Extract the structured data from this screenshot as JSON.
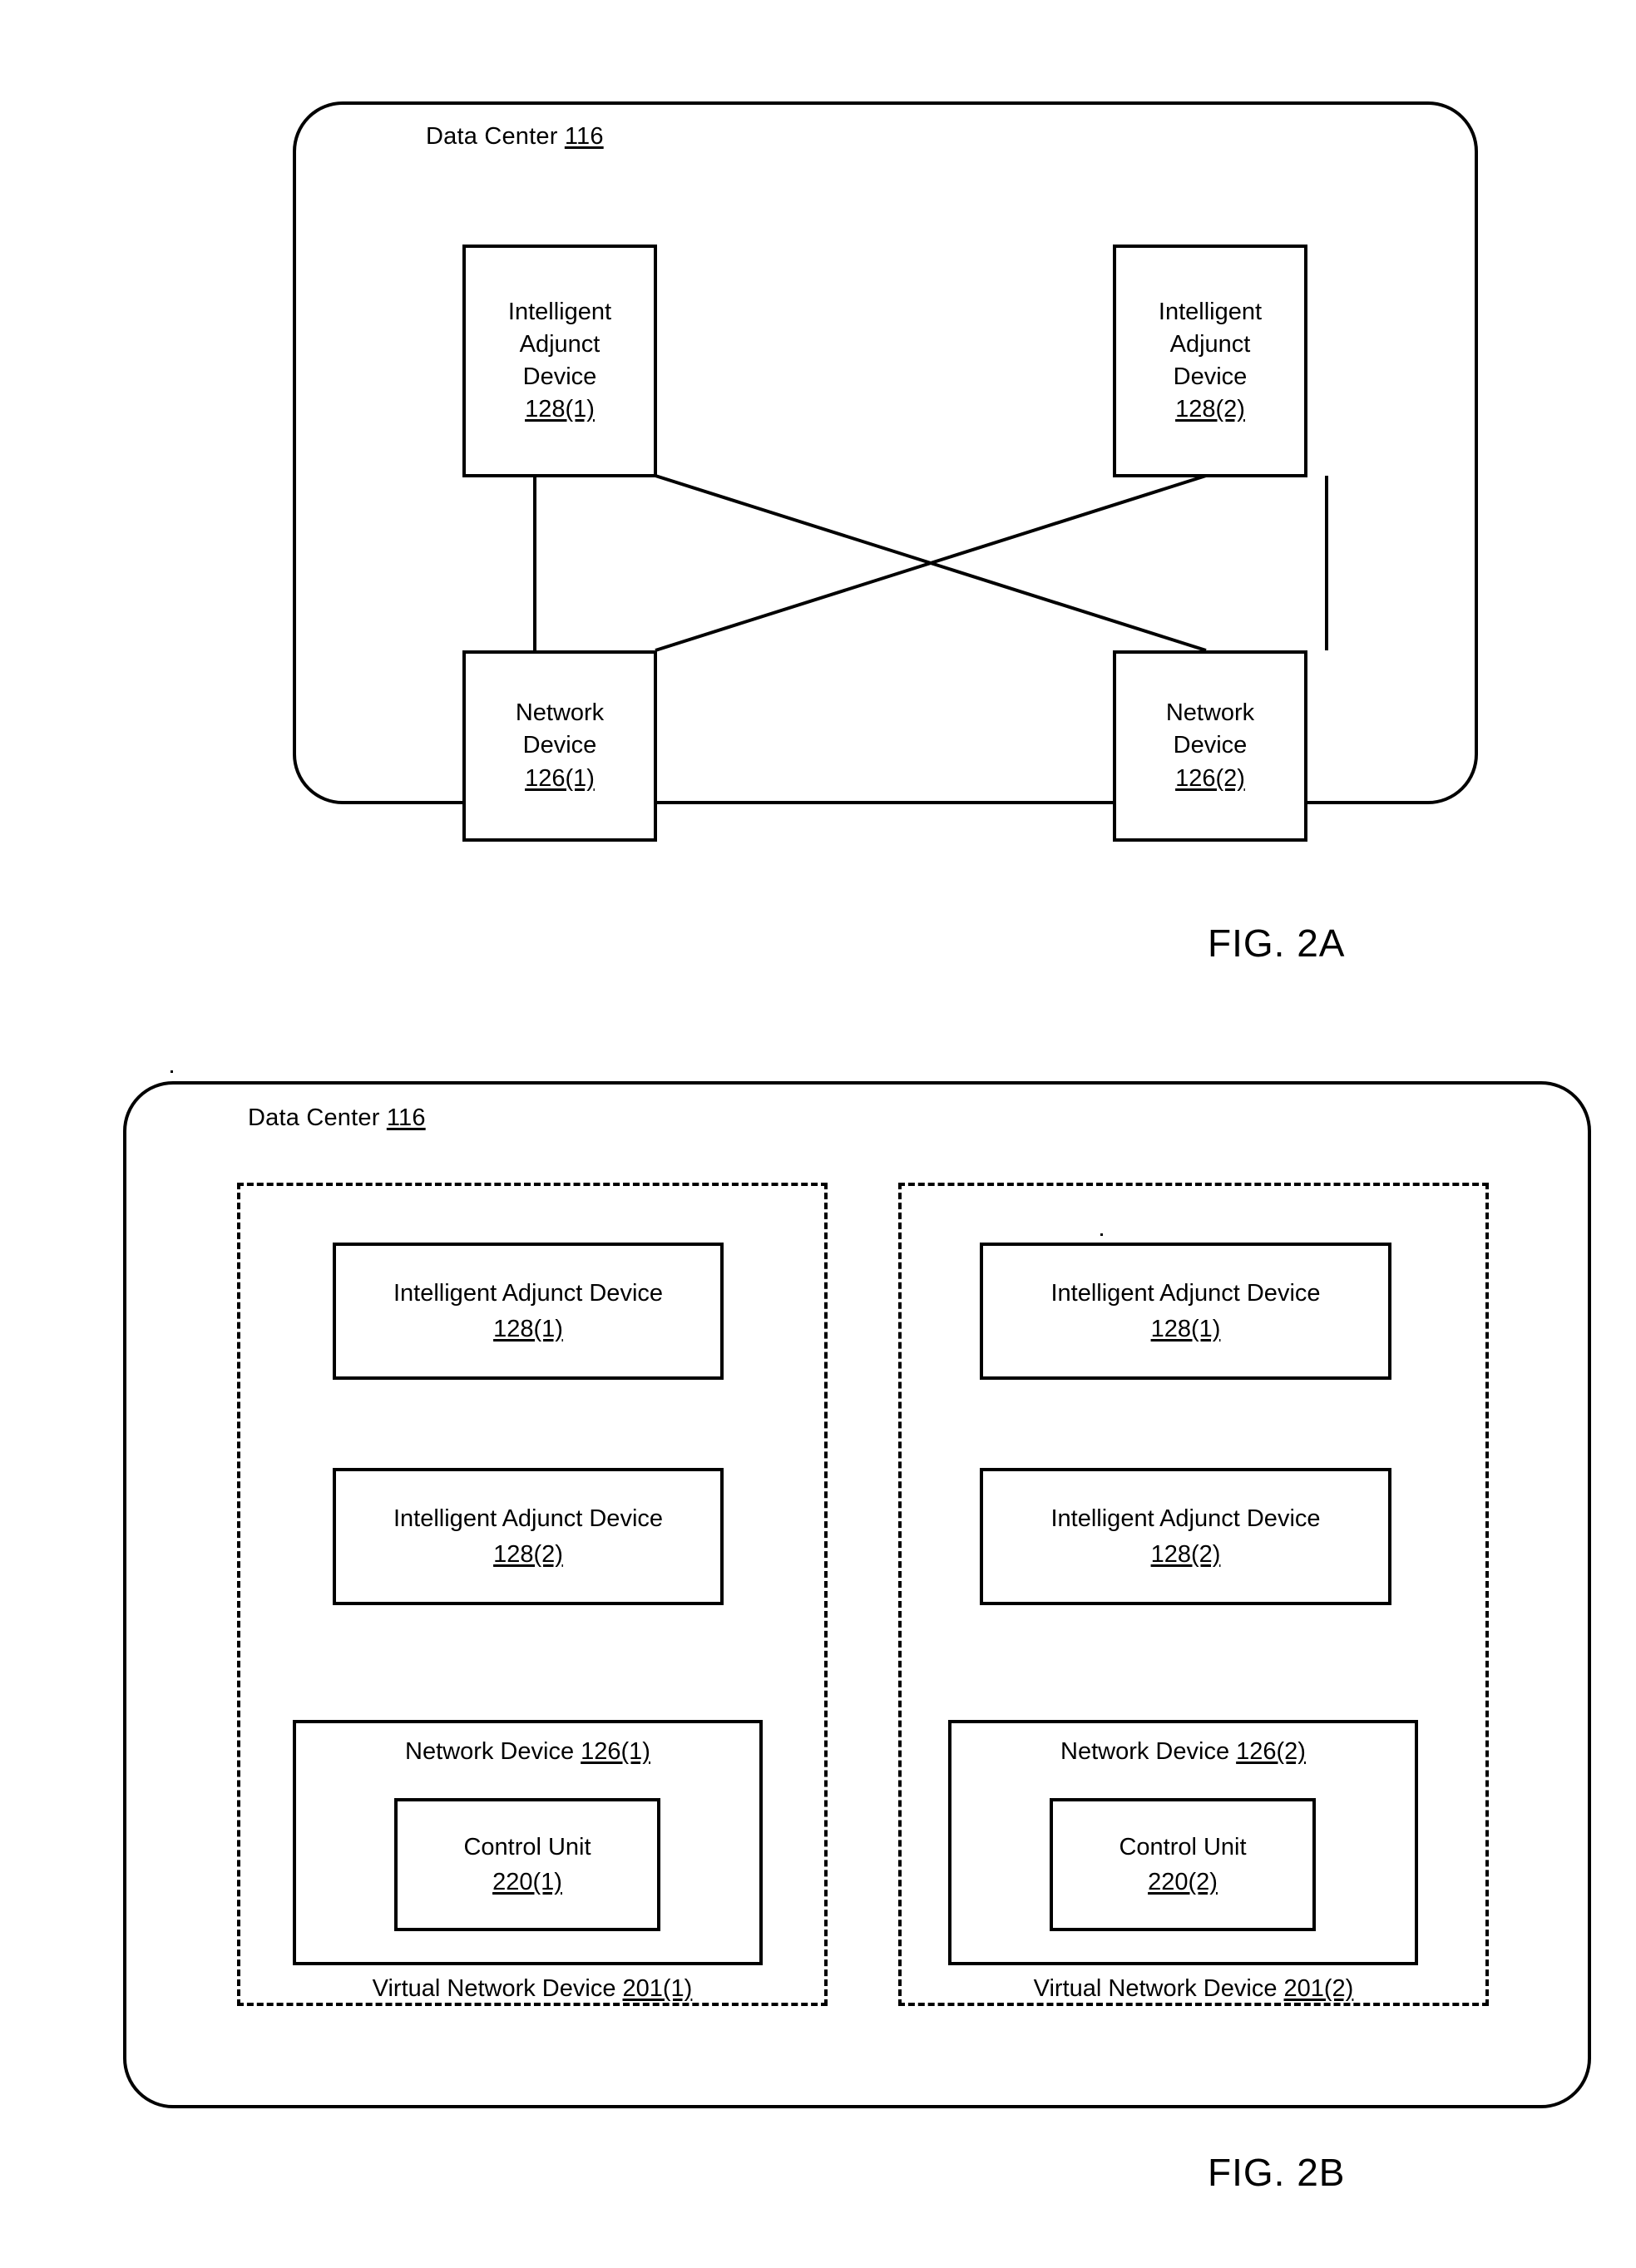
{
  "figures": [
    {
      "id": "fig-2a",
      "caption": "FIG. 2A",
      "container_label_text": "Data Center ",
      "container_label_ref": "116",
      "nodes": {
        "iad1": {
          "lines": [
            "Intelligent",
            "Adjunct",
            "Device"
          ],
          "ref": "128(1)"
        },
        "iad2": {
          "lines": [
            "Intelligent",
            "Adjunct",
            "Device"
          ],
          "ref": "128(2)"
        },
        "nd1": {
          "lines": [
            "Network",
            "Device"
          ],
          "ref": "126(1)"
        },
        "nd2": {
          "lines": [
            "Network",
            "Device"
          ],
          "ref": "126(2)"
        }
      }
    },
    {
      "id": "fig-2b",
      "caption": "FIG. 2B",
      "container_label_text": "Data Center ",
      "container_label_ref": "116",
      "groups": [
        {
          "group_label_text": "Virtual Network Device ",
          "group_label_ref": "201(1)",
          "adjuncts": [
            {
              "title": "Intelligent Adjunct Device",
              "ref": "128(1)"
            },
            {
              "title": "Intelligent Adjunct Device",
              "ref": "128(2)"
            }
          ],
          "network_device": {
            "title": "Network Device ",
            "ref": "126(1)",
            "control_unit": {
              "title": "Control Unit",
              "ref": "220(1)"
            }
          }
        },
        {
          "group_label_text": "Virtual Network Device ",
          "group_label_ref": "201(2)",
          "adjuncts": [
            {
              "title": "Intelligent Adjunct Device",
              "ref": "128(1)"
            },
            {
              "title": "Intelligent Adjunct Device",
              "ref": "128(2)"
            }
          ],
          "network_device": {
            "title": "Network Device ",
            "ref": "126(2)",
            "control_unit": {
              "title": "Control Unit",
              "ref": "220(2)"
            }
          }
        }
      ]
    }
  ],
  "colors": {
    "line": "#000000",
    "background": "#ffffff"
  }
}
